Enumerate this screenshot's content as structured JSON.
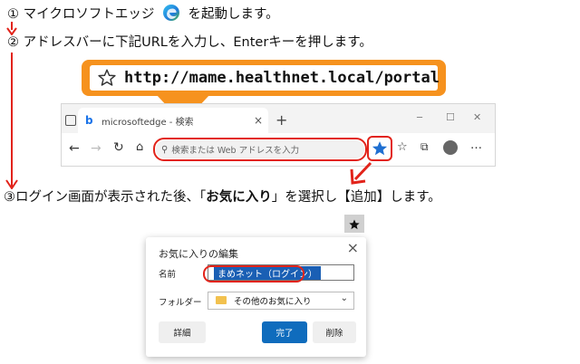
{
  "steps": {
    "s1_num": "①",
    "s1_text": "マイクロソフトエッジ",
    "s1_after": "を起動します。",
    "s2_num": "②",
    "s2_text": "アドレスバーに下記URLを入力し、Enterキーを押します。",
    "s3_pre": "③ログイン画面が表示された後、「",
    "s3_bold": "お気に入り",
    "s3_post": "」を選択し【追加】します。"
  },
  "callout": {
    "url": "http://mame.healthnet.local/portal"
  },
  "browser": {
    "tab_title": "microsoftedge - 検索",
    "tab_close": "×",
    "new_tab": "+",
    "address_placeholder": "検索または Web アドレスを入力",
    "win_minimize": "─",
    "win_maximize": "☐",
    "win_close": "✕"
  },
  "dialog": {
    "title": "お気に入りの編集",
    "name_label": "名前",
    "name_value": "まめネット（ログイン）",
    "folder_label": "フォルダー",
    "folder_value": "その他のお気に入り",
    "more_button": "詳細",
    "done_button": "完了",
    "delete_button": "削除"
  },
  "colors": {
    "accent_red": "#e2231a",
    "callout_orange": "#f6921e",
    "primary_blue": "#0f6cbd"
  }
}
